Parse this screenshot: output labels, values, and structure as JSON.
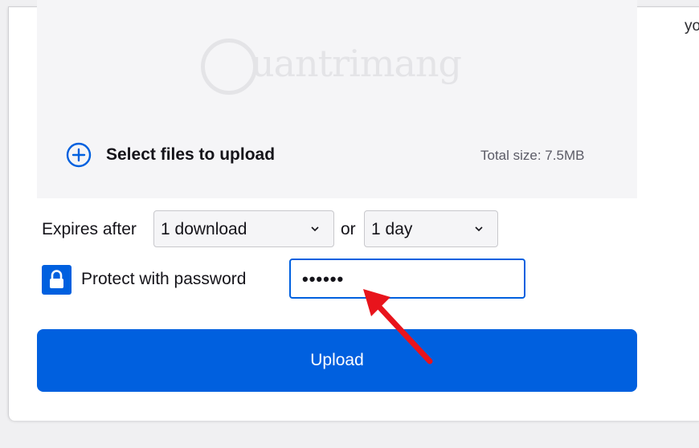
{
  "dropzone": {
    "watermark_text": "uantrimang",
    "select_files_label": "Select files to upload",
    "total_size": "Total size: 7.5MB"
  },
  "expiry": {
    "label": "Expires after",
    "downloads_value": "1 download",
    "or_label": "or",
    "time_value": "1 day"
  },
  "password": {
    "label": "Protect with password",
    "value_masked": "••••••"
  },
  "upload_label": "Upload",
  "right_edge_text": "yo",
  "colors": {
    "accent": "#0060df",
    "annotation_arrow": "#e8141c"
  }
}
